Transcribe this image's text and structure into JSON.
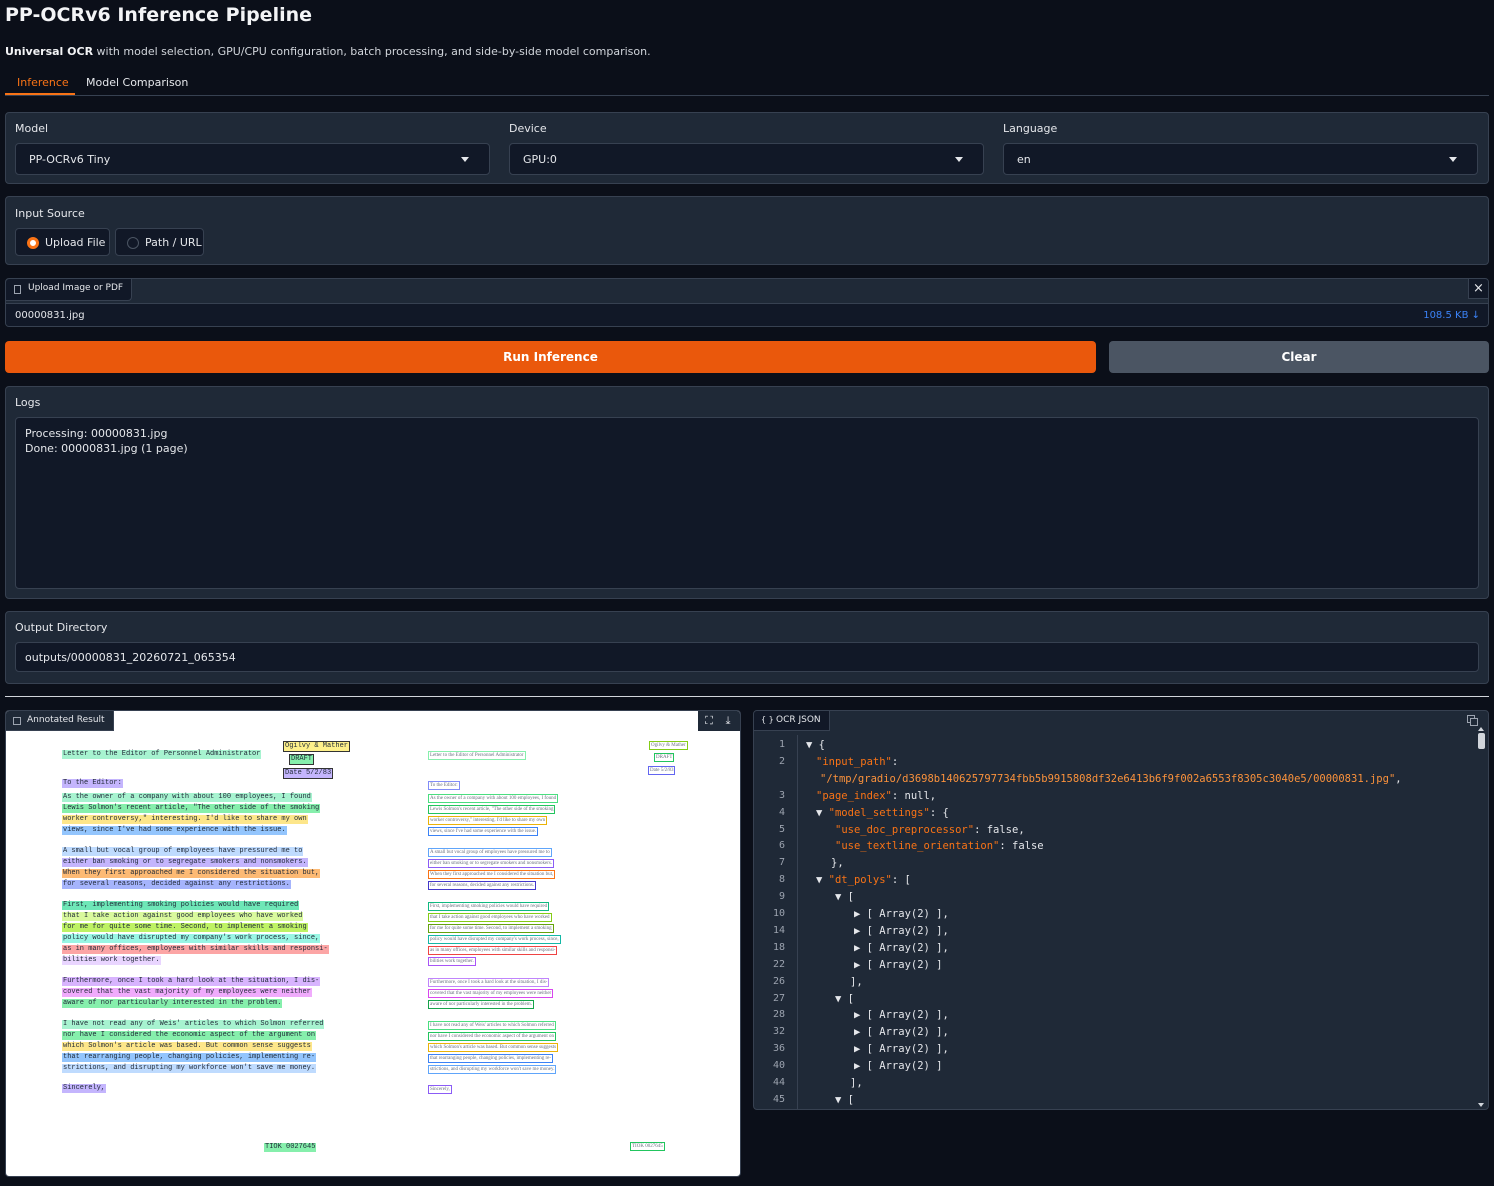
{
  "app": {
    "title": "PP-OCRv6 Inference Pipeline",
    "subtitle_bold": "Universal OCR",
    "subtitle_rest": " with model selection, GPU/CPU configuration, batch processing, and side-by-side model comparison."
  },
  "tabs": [
    {
      "label": "Inference",
      "active": true
    },
    {
      "label": "Model Comparison",
      "active": false
    }
  ],
  "config": {
    "model_label": "Model",
    "model_value": "PP-OCRv6 Tiny",
    "device_label": "Device",
    "device_value": "GPU:0",
    "language_label": "Language",
    "language_value": "en"
  },
  "input_source": {
    "label": "Input Source",
    "options": [
      "Upload File",
      "Path / URL"
    ],
    "selected": "Upload File"
  },
  "upload": {
    "label": "Upload Image or PDF",
    "file_name": "00000831.jpg",
    "file_size": "108.5 KB ↓",
    "close": "×"
  },
  "buttons": {
    "run": "Run Inference",
    "clear": "Clear"
  },
  "logs": {
    "label": "Logs",
    "lines": [
      "Processing: 00000831.jpg",
      "Done: 00000831.jpg (1 page)"
    ]
  },
  "output": {
    "label": "Output Directory",
    "value": "outputs/00000831_20260721_065354"
  },
  "annotated": {
    "label": "Annotated Result",
    "fullscreen": "⛶",
    "download": "⤓",
    "doc": {
      "header": "Letter to the Editor of Personnel Administrator",
      "stamp_line1": "Ogilvy & Mather",
      "stamp_line2": "DRAFT",
      "stamp_line3": "Date 5/2/83",
      "greeting": "To the Editor:",
      "lines": [
        "As the owner of a company with about 100 employees, I found",
        "Lewis Solmon's recent article, \"The other side of the smoking",
        "worker controversy,\" interesting.  I'd like to share my own",
        "views, since I've had some experience with the issue.",
        "A small but vocal group of employees have pressured me to",
        "either ban smoking or to segregate smokers and nonsmokers.",
        "When they first approached me I considered the situation but,",
        "for several reasons, decided against any restrictions.",
        "First, implementing smoking policies would have required",
        "that I take action against good employees who have worked",
        "for me for quite some time.  Second, to implement a smoking",
        "policy would have disrupted my company's work process, since,",
        "as in many offices, employees with similar skills and responsi-",
        "bilities work together.",
        "Furthermore, once I took a hard look at the situation, I dis-",
        "covered that the vast majority of my employees were neither",
        "aware of nor particularly interested in the problem.",
        "I have not read any of Weis' articles to which Solmon referred",
        "nor have I considered the economic aspect of the argument on",
        "which Solmon's article was based.  But common sense suggests",
        "that rearranging people, changing policies, implementing re-",
        "strictions, and disrupting my workforce won't save me money.",
        "Sincerely,"
      ],
      "footer": "TIOK 0027645"
    }
  },
  "json_viewer": {
    "label": "OCR JSON",
    "lines": [
      {
        "n": "1",
        "text": "▼ {"
      },
      {
        "n": "2",
        "key": "\"input_path\"",
        "rest": ":"
      },
      {
        "n": "",
        "str": "\"/tmp/gradio/d3698b140625797734fbb5b9915808df32e6413b6f9f002a6553f8305c3040e5/00000831.jpg\"",
        "rest": ","
      },
      {
        "n": "3",
        "key": "\"page_index\"",
        "rest": ": null,"
      },
      {
        "n": "4",
        "text": "▼ ",
        "key": "\"model_settings\"",
        "rest": ": {"
      },
      {
        "n": "5",
        "key": "\"use_doc_preprocessor\"",
        "rest": ": false,"
      },
      {
        "n": "6",
        "key": "\"use_textline_orientation\"",
        "rest": ": false"
      },
      {
        "n": "7",
        "text": "},"
      },
      {
        "n": "8",
        "text": "▼ ",
        "key": "\"dt_polys\"",
        "rest": ": ["
      },
      {
        "n": "9",
        "text": "▼ ["
      },
      {
        "n": "10",
        "text": "▶ [ Array(2) ],"
      },
      {
        "n": "14",
        "text": "▶ [ Array(2) ],"
      },
      {
        "n": "18",
        "text": "▶ [ Array(2) ],"
      },
      {
        "n": "22",
        "text": "▶ [ Array(2) ]"
      },
      {
        "n": "26",
        "text": "],"
      },
      {
        "n": "27",
        "text": "▼ ["
      },
      {
        "n": "28",
        "text": "▶ [ Array(2) ],"
      },
      {
        "n": "32",
        "text": "▶ [ Array(2) ],"
      },
      {
        "n": "36",
        "text": "▶ [ Array(2) ],"
      },
      {
        "n": "40",
        "text": "▶ [ Array(2) ]"
      },
      {
        "n": "44",
        "text": "],"
      },
      {
        "n": "45",
        "text": "▼ ["
      }
    ]
  }
}
